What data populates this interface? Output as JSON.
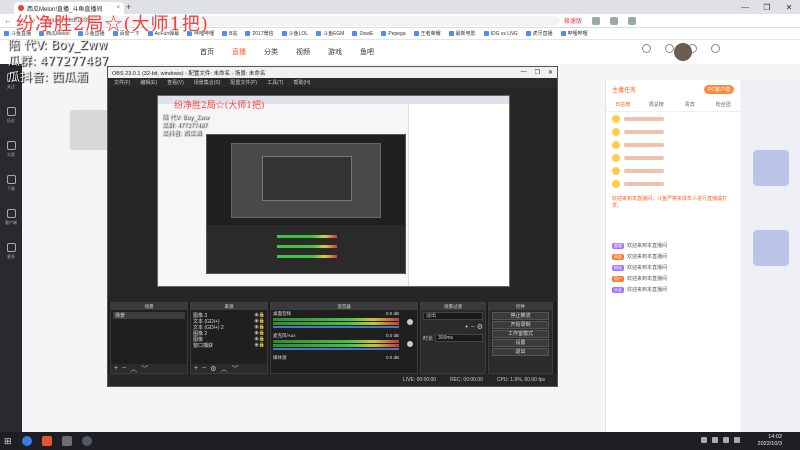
{
  "browser": {
    "tab_title": "西瓜Melon!直播_斗鱼直播间",
    "tab_close": "×",
    "new_tab": "+",
    "address": "douyu.com/103987",
    "address_right": "极速版",
    "window_controls": [
      "—",
      "❐",
      "✕"
    ],
    "bookmarks": [
      "斗鱼直播",
      "西瓜Melon",
      "斗鱼直播",
      "百度一下",
      "AcFun弹幕",
      "哔哩哔哩",
      "B站",
      "2017微信",
      "斗鱼LOL",
      "斗鱼EGM",
      "ZowiE",
      "Pepega",
      "王者荣耀",
      "最新电影",
      "IDG vs LNG",
      "虎牙直播",
      "哔哩哔哩"
    ]
  },
  "site": {
    "nav": [
      "首页",
      "直播",
      "分类",
      "视频",
      "游戏",
      "鱼吧"
    ],
    "active_nav": "直播",
    "rail": [
      "关注",
      "历史",
      "分类",
      "下载",
      "客户端",
      "更多"
    ],
    "rp_head_left": "主播任务",
    "rp_head_right": "PC客户端",
    "rp_tabs": [
      "日总榜",
      "周总榜",
      "贵宾",
      "粉丝团"
    ],
    "notice": "欢迎来到本直播间，斗鱼严禁未成年人进行直播或打赏。",
    "chat": [
      {
        "badge": "超管",
        "text": "欢迎来到本直播间"
      },
      {
        "badge": "贵族",
        "text": "欢迎来到本直播间"
      },
      {
        "badge": "粉丝",
        "text": "欢迎来到本直播间"
      },
      {
        "badge": "用户",
        "text": "欢迎来到本直播间"
      },
      {
        "badge": "水友",
        "text": "欢迎来到本直播间"
      }
    ]
  },
  "overlay": {
    "title": "纷净胜2局☆(大师1把)",
    "line1": "陪 代V: Boy_Zww",
    "line2": "瓜群: 477277487",
    "line3": "瓜抖音: 西瓜酒"
  },
  "obs": {
    "title": "OBS 23.0.1 (32-bit, windows) - 配置文件: 未命名 - 场景: 未命名",
    "menu": [
      "文件(F)",
      "编辑(E)",
      "查看(V)",
      "场景集合(S)",
      "配置文件(P)",
      "工具(T)",
      "帮助(H)"
    ],
    "docks": {
      "scenes_title": "场景",
      "sources_title": "来源",
      "mixer_title": "混音器",
      "transitions_title": "场景过渡",
      "controls_title": "控件"
    },
    "scene_item": "场景",
    "sources": [
      "图像 3",
      "文本 (GDI+)",
      "文本 (GDI+) 2",
      "图像 2",
      "图像",
      "窗口捕获"
    ],
    "mixer": [
      {
        "name": "桌面音频",
        "db": "0.0 dB"
      },
      {
        "name": "麦克风/Aux",
        "db": "0.0 dB"
      },
      {
        "name": "媒体源",
        "db": "0.0 dB"
      }
    ],
    "transition": "淡出",
    "duration_label": "时长",
    "duration": "300ms",
    "controls": [
      "停止推流",
      "开始录制",
      "工作室模式",
      "设置",
      "退出"
    ],
    "status": {
      "live": "LIVE: 00:00:00",
      "rec": "REC: 00:00:00",
      "cpu": "CPU: 1.9%, 60.00 fps"
    }
  },
  "nested": {
    "title": "纷净胜2局☆(大师1把)",
    "line1": "陪 代V: Boy_Zww",
    "line2": "瓜群: 477277487",
    "line3": "瓜抖音: 西瓜酒"
  },
  "taskbar": {
    "time": "14:02",
    "date": "2022/10/3"
  }
}
